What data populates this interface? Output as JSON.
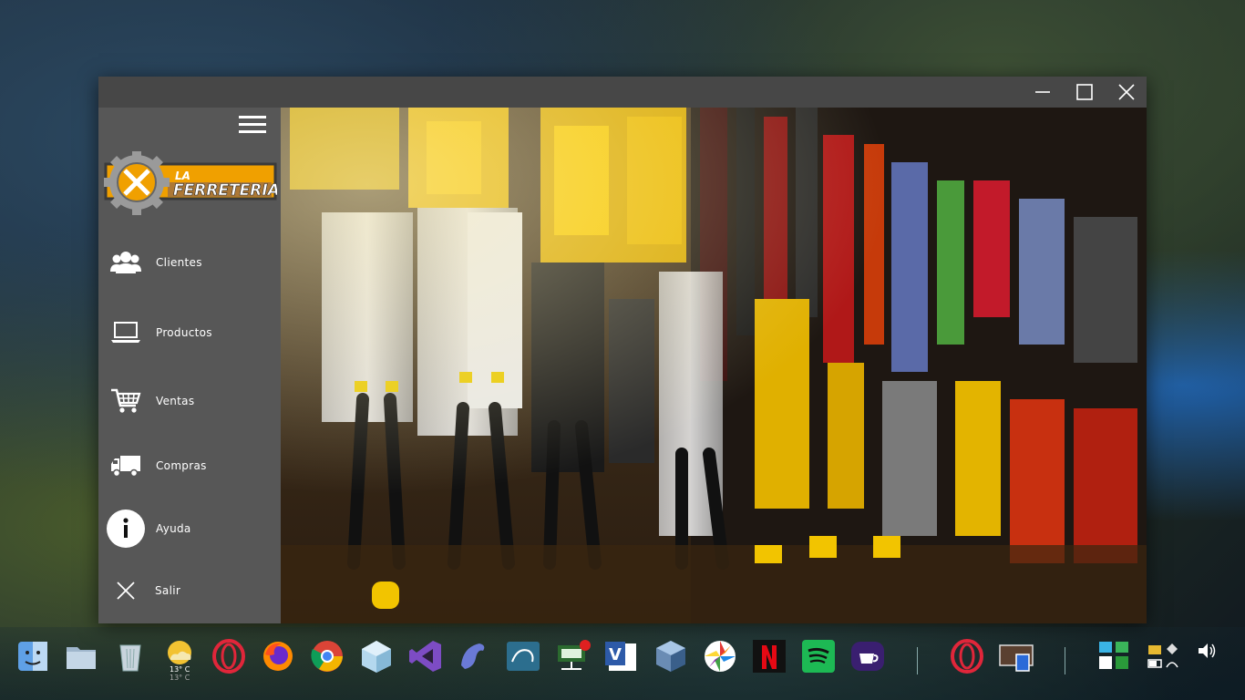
{
  "window": {
    "controls": {
      "minimize_icon": "minimize-icon",
      "maximize_icon": "maximize-icon",
      "close_icon": "close-icon"
    }
  },
  "sidebar": {
    "logo": {
      "line1": "LA",
      "line2": "FERRETERIA",
      "bg": "#f0a000",
      "text_color": "#ffffff"
    },
    "menu_icon": "hamburger-menu-icon",
    "items": [
      {
        "label": "Clientes",
        "icon": "users-icon"
      },
      {
        "label": "Productos",
        "icon": "laptop-icon"
      },
      {
        "label": "Ventas",
        "icon": "shopping-cart-icon"
      },
      {
        "label": "Compras",
        "icon": "truck-icon"
      },
      {
        "label": "Ayuda",
        "icon": "info-icon"
      },
      {
        "label": "Salir",
        "icon": "close-icon"
      }
    ]
  },
  "content": {
    "image": "hardware-store-tools-photo"
  },
  "weather": {
    "temp_high": "13° C",
    "temp_low": "13° C"
  },
  "dock": {
    "apps": [
      "finder",
      "files",
      "trash",
      "weather",
      "opera",
      "firefox",
      "chrome",
      "cube-app",
      "visual-studio",
      "dolphin-app",
      "mysql-workbench",
      "network-app",
      "visio",
      "virtualbox",
      "aperture",
      "netflix",
      "spotify",
      "java-app",
      "opera",
      "screenshot-app"
    ]
  },
  "colors": {
    "titlebar": "#474747",
    "sidebar": "#575757",
    "accent": "#f0a000"
  }
}
